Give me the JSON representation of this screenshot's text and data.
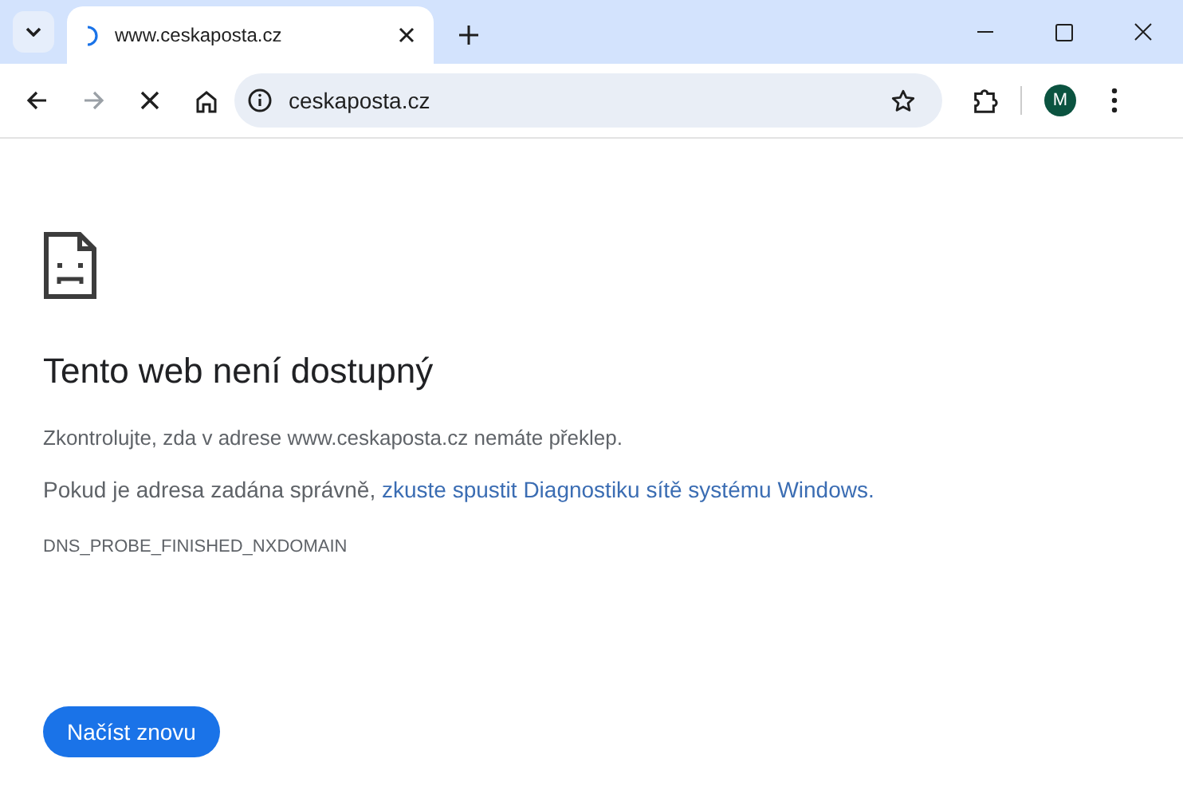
{
  "tab": {
    "title": "www.ceskaposta.cz",
    "loading": true
  },
  "address_bar": {
    "value": "ceskaposta.cz"
  },
  "profile": {
    "initial": "M"
  },
  "error_page": {
    "heading": "Tento web není dostupný",
    "message": "Zkontrolujte, zda v adrese www.ceskaposta.cz nemáte překlep.",
    "suggestion": {
      "text": "Pokud je adresa zadána správně, ",
      "link": "zkuste spustit Diagnostiku sítě systému Windows."
    },
    "error_code": "DNS_PROBE_FINISHED_NXDOMAIN",
    "button": "Načíst znovu"
  }
}
